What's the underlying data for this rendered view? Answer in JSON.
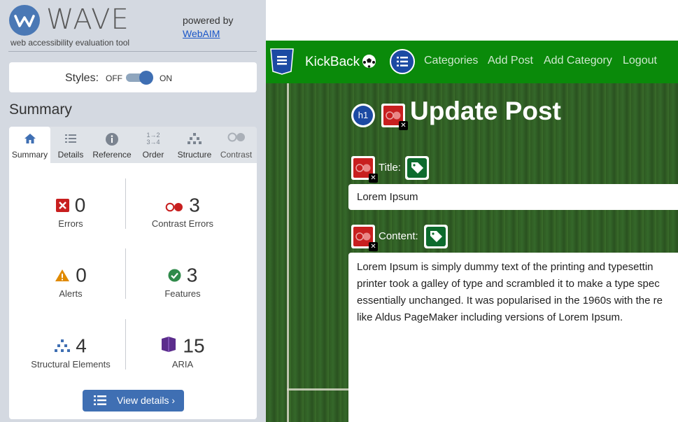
{
  "wave": {
    "logo_text": "WAVE",
    "tagline": "web accessibility evaluation tool",
    "powered_by": "powered by",
    "webaim_link": "WebAIM",
    "styles": {
      "label": "Styles:",
      "off": "OFF",
      "on": "ON",
      "state": "on"
    },
    "summary_title": "Summary",
    "tabs": [
      {
        "label": "Summary",
        "icon": "home-icon",
        "active": true
      },
      {
        "label": "Details",
        "icon": "list-icon"
      },
      {
        "label": "Reference",
        "icon": "info-icon"
      },
      {
        "label": "Order",
        "icon": "order-icon"
      },
      {
        "label": "Structure",
        "icon": "structure-icon"
      },
      {
        "label": "Contrast",
        "icon": "contrast-icon"
      }
    ],
    "stats": {
      "errors": {
        "count": "0",
        "label": "Errors",
        "icon": "error-icon",
        "color": "#c81f1f"
      },
      "contrast_errors": {
        "count": "3",
        "label": "Contrast Errors",
        "icon": "contrast-error-icon",
        "color": "#c81f1f"
      },
      "alerts": {
        "count": "0",
        "label": "Alerts",
        "icon": "alert-icon",
        "color": "#e08a00"
      },
      "features": {
        "count": "3",
        "label": "Features",
        "icon": "feature-check-icon",
        "color": "#2f8a4a"
      },
      "structural": {
        "count": "4",
        "label": "Structural Elements",
        "icon": "structure-icon",
        "color": "#3f6fb3"
      },
      "aria": {
        "count": "15",
        "label": "ARIA",
        "icon": "aria-icon",
        "color": "#5b2d8c"
      }
    },
    "view_details": "View details ›"
  },
  "site": {
    "brand": "KickBack",
    "nav_links": [
      "Categories",
      "Add Post",
      "Add Category",
      "Logout"
    ],
    "heading": "Update Post",
    "title_label": "Title:",
    "title_value": "Lorem Ipsum",
    "content_label": "Content:",
    "content_lines": [
      "Lorem Ipsum is simply dummy text of the printing and typesettin",
      "printer took a galley of type and scrambled it to make a type spec",
      "essentially unchanged. It was popularised in the 1960s with the re",
      "like Aldus PageMaker including versions of Lorem Ipsum."
    ],
    "colors": {
      "navbar": "#0a8a0a",
      "nav_link": "#cfe8cf"
    }
  }
}
